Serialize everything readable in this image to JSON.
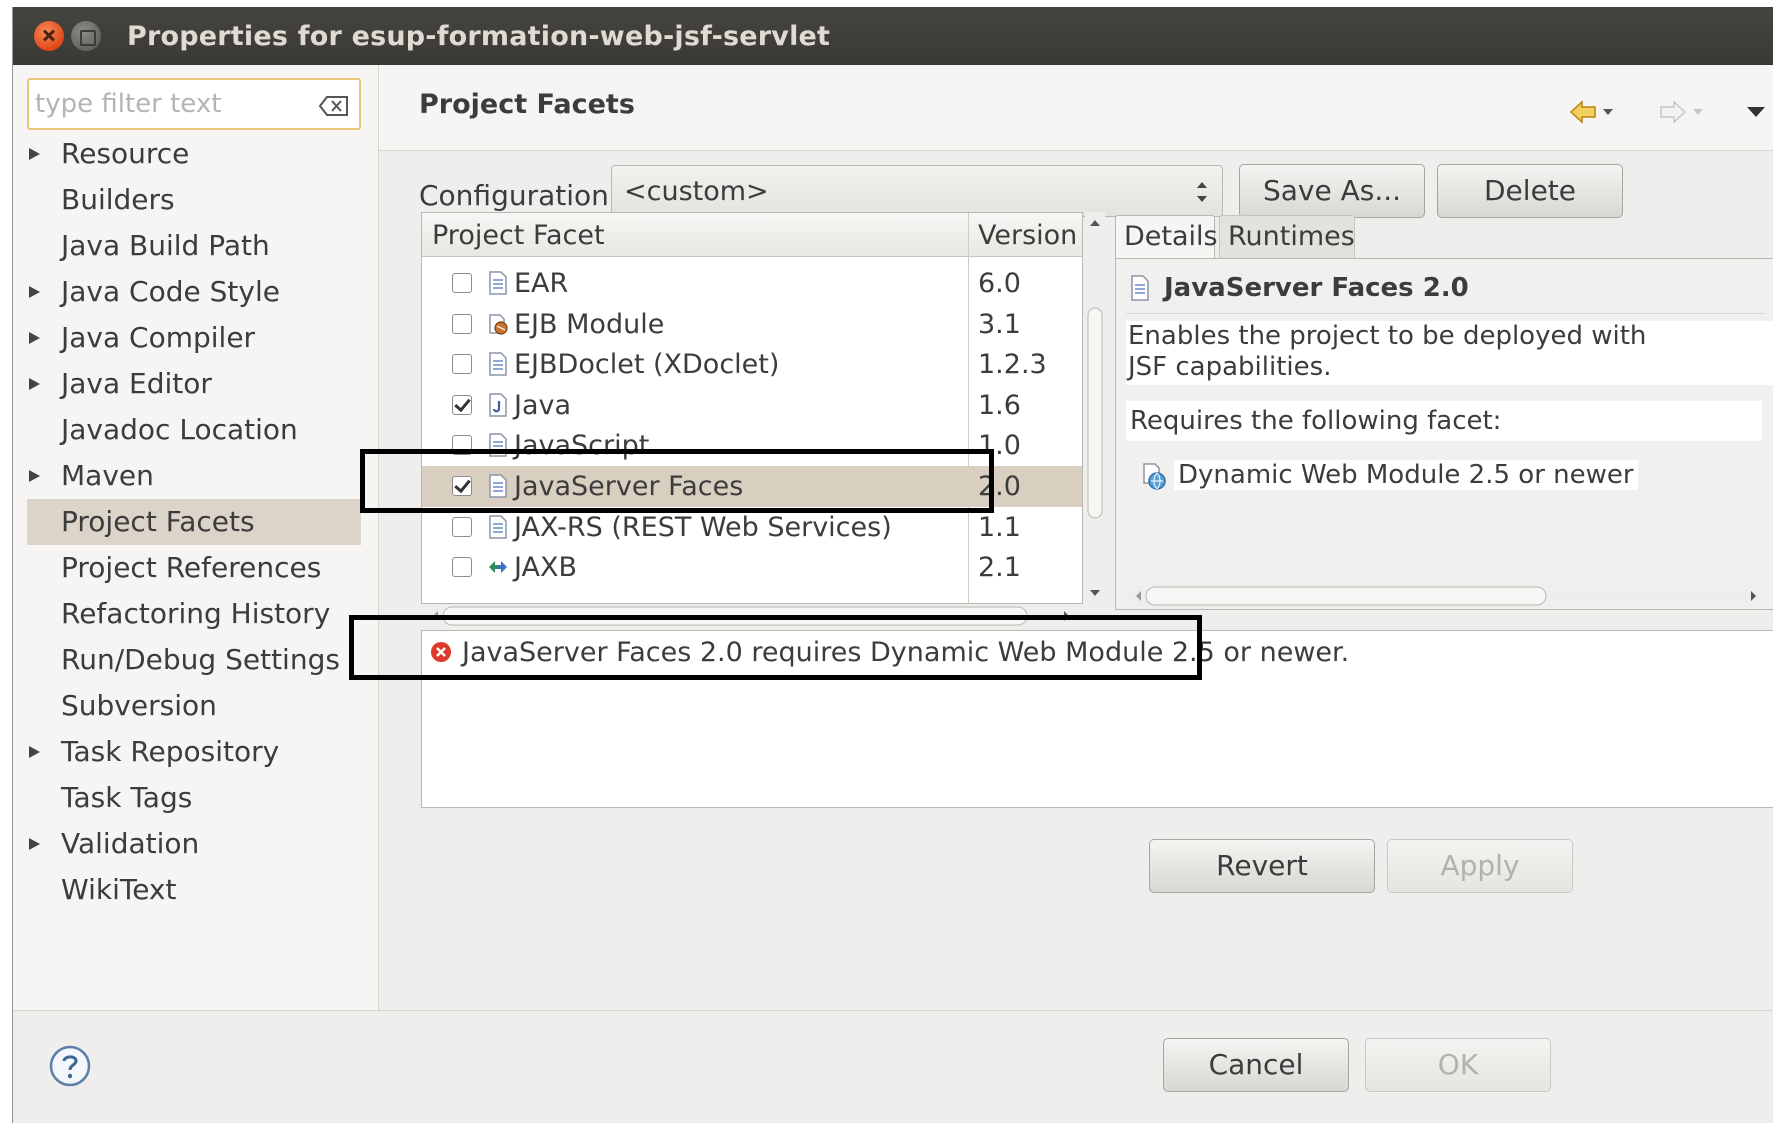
{
  "window": {
    "title": "Properties for esup-formation-web-jsf-servlet"
  },
  "sidebar": {
    "filter_placeholder": "type filter text",
    "items": [
      {
        "label": "Resource",
        "expandable": true
      },
      {
        "label": "Builders",
        "expandable": false
      },
      {
        "label": "Java Build Path",
        "expandable": false
      },
      {
        "label": "Java Code Style",
        "expandable": true
      },
      {
        "label": "Java Compiler",
        "expandable": true
      },
      {
        "label": "Java Editor",
        "expandable": true
      },
      {
        "label": "Javadoc Location",
        "expandable": false
      },
      {
        "label": "Maven",
        "expandable": true
      },
      {
        "label": "Project Facets",
        "expandable": false,
        "selected": true
      },
      {
        "label": "Project References",
        "expandable": false
      },
      {
        "label": "Refactoring History",
        "expandable": false
      },
      {
        "label": "Run/Debug Settings",
        "expandable": false
      },
      {
        "label": "Subversion",
        "expandable": false
      },
      {
        "label": "Task Repository",
        "expandable": true
      },
      {
        "label": "Task Tags",
        "expandable": false
      },
      {
        "label": "Validation",
        "expandable": true
      },
      {
        "label": "WikiText",
        "expandable": false
      }
    ]
  },
  "page": {
    "title": "Project Facets",
    "configuration_label": "Configuration:",
    "configuration_value": "<custom>",
    "save_as_label": "Save As...",
    "delete_label": "Delete"
  },
  "facets": {
    "col_facet": "Project Facet",
    "col_version": "Version",
    "rows": [
      {
        "name": "EAR",
        "version": "6.0",
        "checked": false,
        "icon": "document-icon"
      },
      {
        "name": "EJB Module",
        "version": "3.1",
        "checked": false,
        "icon": "ejb-module-icon"
      },
      {
        "name": "EJBDoclet (XDoclet)",
        "version": "1.2.3",
        "checked": false,
        "icon": "document-icon"
      },
      {
        "name": "Java",
        "version": "1.6",
        "checked": true,
        "icon": "java-icon"
      },
      {
        "name": "JavaScript",
        "version": "1.0",
        "checked": false,
        "icon": "document-icon"
      },
      {
        "name": "JavaServer Faces",
        "version": "2.0",
        "checked": true,
        "selected": true,
        "icon": "document-icon"
      },
      {
        "name": "JAX-RS (REST Web Services)",
        "version": "1.1",
        "checked": false,
        "icon": "document-icon"
      },
      {
        "name": "JAXB",
        "version": "2.1",
        "checked": false,
        "icon": "jaxb-arrows-icon"
      }
    ]
  },
  "details": {
    "tab_details": "Details",
    "tab_runtimes": "Runtimes",
    "title": "JavaServer Faces 2.0",
    "description": "Enables the project to be deployed with JSF capabilities.",
    "desc_line1": "Enables the project to be deployed with",
    "desc_line2": "JSF capabilities.",
    "requires_label": "Requires the following facet:",
    "requirement": "Dynamic Web Module 2.5 or newer"
  },
  "problems": {
    "message": "JavaServer Faces 2.0 requires Dynamic Web Module 2.5 or newer."
  },
  "actions": {
    "revert_label": "Revert",
    "apply_label": "Apply",
    "cancel_label": "Cancel",
    "ok_label": "OK"
  },
  "colors": {
    "titlebar": "#3c3b37",
    "selection": "#d9cfc1",
    "error": "#e0392d",
    "filter_border": "#e8c77a"
  }
}
